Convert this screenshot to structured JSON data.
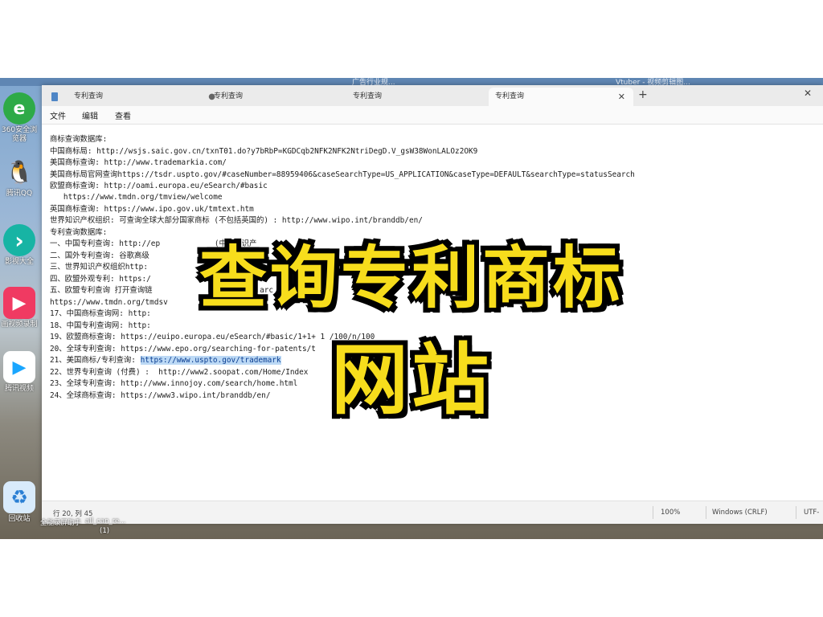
{
  "desktop_top_text": [
    "广告行业规...",
    "Vtuber - 视频剪辑图..."
  ],
  "desktop_icons": [
    {
      "name": "360-browser",
      "label": "360安全浏览器",
      "color": "#27a344",
      "glyph": "e"
    },
    {
      "name": "tencent-qq",
      "label": "腾讯QQ",
      "color": "#1e1e1e",
      "glyph": "🐧"
    },
    {
      "name": "xunlei",
      "label": "影视大全",
      "color": "#17b4a4",
      "glyph": "›"
    },
    {
      "name": "video-maker",
      "label": "画视频录制",
      "color": "#f03a62",
      "glyph": "▶"
    },
    {
      "name": "tencent-video",
      "label": "腾讯视频",
      "color": "#ffffff",
      "glyph": "▶"
    },
    {
      "name": "recycle-bin",
      "label": "回收站",
      "color": "#cfe3f7",
      "glyph": "♻"
    }
  ],
  "taskbar_items": [
    "全能录屏助手",
    "all_can_re...",
    "(1)"
  ],
  "tabs": [
    "专利查询",
    "专利查询",
    "专利查询",
    "专利查询"
  ],
  "new_tab": "+",
  "window_controls": [
    "—",
    "▢",
    "✕"
  ],
  "menu": [
    "文件",
    "编辑",
    "查看"
  ],
  "lines": [
    "商标查询数据库:",
    "中国商标局: http://wsjs.saic.gov.cn/txnT01.do?y7bRbP=KGDCqb2NFK2NFK2NtriDegD.V_gsW38WonLALOz2OK9",
    "美国商标查询: http://www.trademarkia.com/",
    "美国商标局官网查询https://tsdr.uspto.gov/#caseNumber=88959406&caseSearchType=US_APPLICATION&caseType=DEFAULT&searchType=statusSearch",
    "欧盟商标查询: http://oami.europa.eu/eSearch/#basic",
    "   https://www.tmdn.org/tmview/welcome",
    "英国商标查询: https://www.ipo.gov.uk/tmtext.htm",
    "世界知识产权组织: 可查询全球大部分国家商标 (不包括英国的) : http://www.wipo.int/branddb/en/",
    "专利查询数据库:",
    "一、中国专利查询: http://ep            (中国知识产",
    "二、国外专利查询: 谷歌高级",
    "三、世界知识产权组织http:                                                               的外观专利)",
    "四、欧盟外观专利: https:/",
    "五、欧盟专利查询 打开查询链                输      arc",
    "https://www.tmdn.org/tmdsv                e",
    "17、中国商标查询网: http:",
    "18、中国专利查询网: http:",
    "19、欧盟商标查询: https://euipo.europa.eu/eSearch/#basic/1+1+ 1 /100/n/100",
    "20、全球专利查询: https://www.epo.org/searching-for-patents/t",
    "21、美国商标/专利查询: ",
    "22、世界专利查询 (付费) :  http://www2.soopat.com/Home/Index",
    "23、全球专利查询: http://www.innojoy.com/search/home.html",
    "24、全球商标查询: https://www3.wipo.int/branddb/en/"
  ],
  "highlighted_url": "https://www.uspto.gov/trademark",
  "status": {
    "position": "行 20, 列 45",
    "zoom": "100%",
    "eol": "Windows (CRLF)",
    "encoding": "UTF-"
  },
  "overlay": {
    "line1": "查询专利商标",
    "line2": "网站"
  },
  "colors": {
    "overlay_text": "#f7dd1c",
    "selection": "#bcd9f5"
  }
}
